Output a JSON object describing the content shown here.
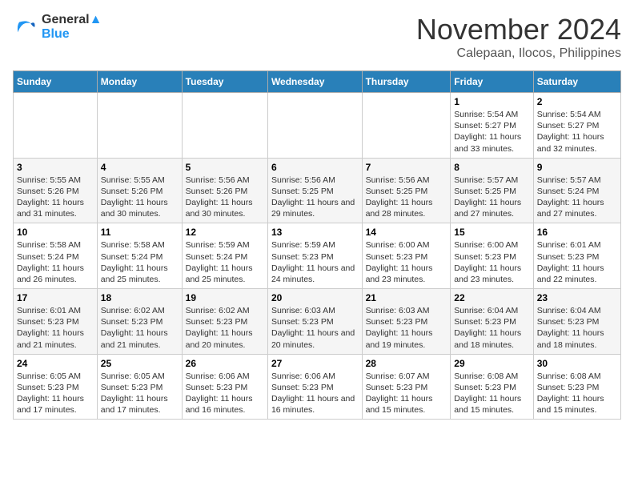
{
  "header": {
    "logo_line1": "General",
    "logo_line2": "Blue",
    "month": "November 2024",
    "location": "Calepaan, Ilocos, Philippines"
  },
  "weekdays": [
    "Sunday",
    "Monday",
    "Tuesday",
    "Wednesday",
    "Thursday",
    "Friday",
    "Saturday"
  ],
  "weeks": [
    [
      {
        "day": "",
        "sunrise": "",
        "sunset": "",
        "daylight": ""
      },
      {
        "day": "",
        "sunrise": "",
        "sunset": "",
        "daylight": ""
      },
      {
        "day": "",
        "sunrise": "",
        "sunset": "",
        "daylight": ""
      },
      {
        "day": "",
        "sunrise": "",
        "sunset": "",
        "daylight": ""
      },
      {
        "day": "",
        "sunrise": "",
        "sunset": "",
        "daylight": ""
      },
      {
        "day": "1",
        "sunrise": "Sunrise: 5:54 AM",
        "sunset": "Sunset: 5:27 PM",
        "daylight": "Daylight: 11 hours and 33 minutes."
      },
      {
        "day": "2",
        "sunrise": "Sunrise: 5:54 AM",
        "sunset": "Sunset: 5:27 PM",
        "daylight": "Daylight: 11 hours and 32 minutes."
      }
    ],
    [
      {
        "day": "3",
        "sunrise": "Sunrise: 5:55 AM",
        "sunset": "Sunset: 5:26 PM",
        "daylight": "Daylight: 11 hours and 31 minutes."
      },
      {
        "day": "4",
        "sunrise": "Sunrise: 5:55 AM",
        "sunset": "Sunset: 5:26 PM",
        "daylight": "Daylight: 11 hours and 30 minutes."
      },
      {
        "day": "5",
        "sunrise": "Sunrise: 5:56 AM",
        "sunset": "Sunset: 5:26 PM",
        "daylight": "Daylight: 11 hours and 30 minutes."
      },
      {
        "day": "6",
        "sunrise": "Sunrise: 5:56 AM",
        "sunset": "Sunset: 5:25 PM",
        "daylight": "Daylight: 11 hours and 29 minutes."
      },
      {
        "day": "7",
        "sunrise": "Sunrise: 5:56 AM",
        "sunset": "Sunset: 5:25 PM",
        "daylight": "Daylight: 11 hours and 28 minutes."
      },
      {
        "day": "8",
        "sunrise": "Sunrise: 5:57 AM",
        "sunset": "Sunset: 5:25 PM",
        "daylight": "Daylight: 11 hours and 27 minutes."
      },
      {
        "day": "9",
        "sunrise": "Sunrise: 5:57 AM",
        "sunset": "Sunset: 5:24 PM",
        "daylight": "Daylight: 11 hours and 27 minutes."
      }
    ],
    [
      {
        "day": "10",
        "sunrise": "Sunrise: 5:58 AM",
        "sunset": "Sunset: 5:24 PM",
        "daylight": "Daylight: 11 hours and 26 minutes."
      },
      {
        "day": "11",
        "sunrise": "Sunrise: 5:58 AM",
        "sunset": "Sunset: 5:24 PM",
        "daylight": "Daylight: 11 hours and 25 minutes."
      },
      {
        "day": "12",
        "sunrise": "Sunrise: 5:59 AM",
        "sunset": "Sunset: 5:24 PM",
        "daylight": "Daylight: 11 hours and 25 minutes."
      },
      {
        "day": "13",
        "sunrise": "Sunrise: 5:59 AM",
        "sunset": "Sunset: 5:23 PM",
        "daylight": "Daylight: 11 hours and 24 minutes."
      },
      {
        "day": "14",
        "sunrise": "Sunrise: 6:00 AM",
        "sunset": "Sunset: 5:23 PM",
        "daylight": "Daylight: 11 hours and 23 minutes."
      },
      {
        "day": "15",
        "sunrise": "Sunrise: 6:00 AM",
        "sunset": "Sunset: 5:23 PM",
        "daylight": "Daylight: 11 hours and 23 minutes."
      },
      {
        "day": "16",
        "sunrise": "Sunrise: 6:01 AM",
        "sunset": "Sunset: 5:23 PM",
        "daylight": "Daylight: 11 hours and 22 minutes."
      }
    ],
    [
      {
        "day": "17",
        "sunrise": "Sunrise: 6:01 AM",
        "sunset": "Sunset: 5:23 PM",
        "daylight": "Daylight: 11 hours and 21 minutes."
      },
      {
        "day": "18",
        "sunrise": "Sunrise: 6:02 AM",
        "sunset": "Sunset: 5:23 PM",
        "daylight": "Daylight: 11 hours and 21 minutes."
      },
      {
        "day": "19",
        "sunrise": "Sunrise: 6:02 AM",
        "sunset": "Sunset: 5:23 PM",
        "daylight": "Daylight: 11 hours and 20 minutes."
      },
      {
        "day": "20",
        "sunrise": "Sunrise: 6:03 AM",
        "sunset": "Sunset: 5:23 PM",
        "daylight": "Daylight: 11 hours and 20 minutes."
      },
      {
        "day": "21",
        "sunrise": "Sunrise: 6:03 AM",
        "sunset": "Sunset: 5:23 PM",
        "daylight": "Daylight: 11 hours and 19 minutes."
      },
      {
        "day": "22",
        "sunrise": "Sunrise: 6:04 AM",
        "sunset": "Sunset: 5:23 PM",
        "daylight": "Daylight: 11 hours and 18 minutes."
      },
      {
        "day": "23",
        "sunrise": "Sunrise: 6:04 AM",
        "sunset": "Sunset: 5:23 PM",
        "daylight": "Daylight: 11 hours and 18 minutes."
      }
    ],
    [
      {
        "day": "24",
        "sunrise": "Sunrise: 6:05 AM",
        "sunset": "Sunset: 5:23 PM",
        "daylight": "Daylight: 11 hours and 17 minutes."
      },
      {
        "day": "25",
        "sunrise": "Sunrise: 6:05 AM",
        "sunset": "Sunset: 5:23 PM",
        "daylight": "Daylight: 11 hours and 17 minutes."
      },
      {
        "day": "26",
        "sunrise": "Sunrise: 6:06 AM",
        "sunset": "Sunset: 5:23 PM",
        "daylight": "Daylight: 11 hours and 16 minutes."
      },
      {
        "day": "27",
        "sunrise": "Sunrise: 6:06 AM",
        "sunset": "Sunset: 5:23 PM",
        "daylight": "Daylight: 11 hours and 16 minutes."
      },
      {
        "day": "28",
        "sunrise": "Sunrise: 6:07 AM",
        "sunset": "Sunset: 5:23 PM",
        "daylight": "Daylight: 11 hours and 15 minutes."
      },
      {
        "day": "29",
        "sunrise": "Sunrise: 6:08 AM",
        "sunset": "Sunset: 5:23 PM",
        "daylight": "Daylight: 11 hours and 15 minutes."
      },
      {
        "day": "30",
        "sunrise": "Sunrise: 6:08 AM",
        "sunset": "Sunset: 5:23 PM",
        "daylight": "Daylight: 11 hours and 15 minutes."
      }
    ]
  ]
}
